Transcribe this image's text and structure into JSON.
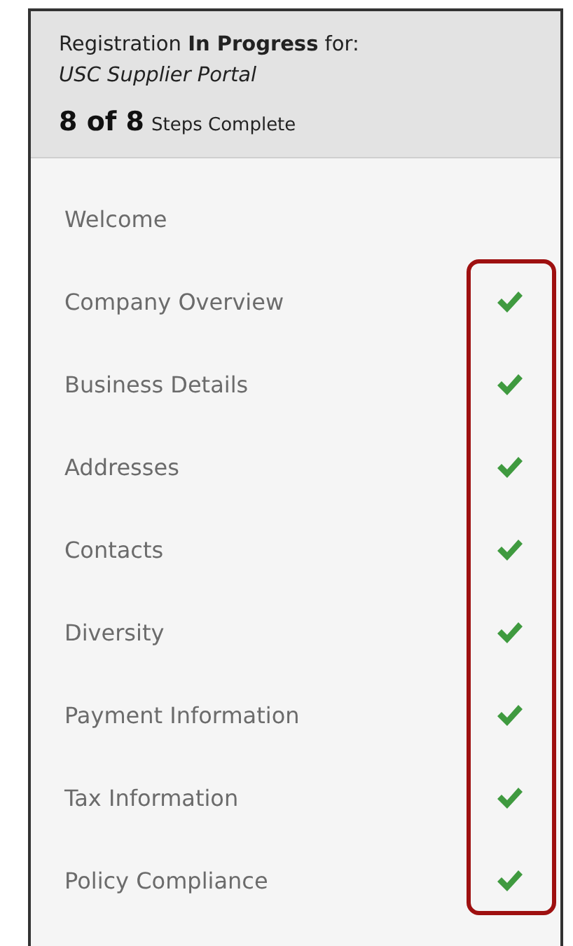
{
  "header": {
    "status_line": "Registration **In Progress** for:",
    "portal": "USC Supplier Portal",
    "progress_count": "8 of 8",
    "progress_label": "Steps Complete"
  },
  "steps": [
    {
      "label": "Welcome",
      "complete": false
    },
    {
      "label": "Company Overview",
      "complete": true
    },
    {
      "label": "Business Details",
      "complete": true
    },
    {
      "label": "Addresses",
      "complete": true
    },
    {
      "label": "Contacts",
      "complete": true
    },
    {
      "label": "Diversity",
      "complete": true
    },
    {
      "label": "Payment Information",
      "complete": true
    },
    {
      "label": "Tax Information",
      "complete": true
    },
    {
      "label": "Policy Compliance",
      "complete": true
    }
  ]
}
